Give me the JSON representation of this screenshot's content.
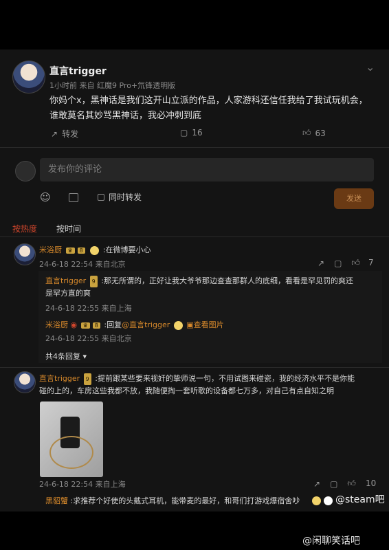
{
  "post": {
    "author": "直言trigger",
    "meta": "1小时前  来自 红魔9 Pro+氘锋透明版",
    "text_line1": "你妈个x，黑神话是我们这开山立派的作品，人家游科还信任我给了我试玩机会，",
    "text_line2": "谁敢莫名其妙骂黑神话，我必冲刺到底",
    "repost_label": "转发",
    "comment_count": "16",
    "like_count": "63"
  },
  "composer": {
    "placeholder": "发布你的评论",
    "repost_checkbox_label": "同时转发",
    "send_label": "发送"
  },
  "sort_tabs": {
    "hot": "按热度",
    "time": "按时间"
  },
  "comments": [
    {
      "user": "米浴厨",
      "text": ":在微博要小心",
      "meta": "24-6-18 22:54 来自北京",
      "like_count": "7",
      "replies": [
        {
          "user": "直言trigger",
          "text_line1": ":那无所谓的，正好让我大爷爷那边查查那群人的底细，看看是罕见罚的爽还",
          "text_line2": "是罕方直的爽",
          "meta": "24-6-18 22:55 来自上海"
        },
        {
          "user": "米浴厨",
          "text_prefix": ":回复",
          "mention": "@直言trigger",
          "view_image": "查看图片",
          "meta": "24-6-18 22:55 来自北京"
        }
      ],
      "more_replies": "共4条回复"
    },
    {
      "user": "直言trigger",
      "text_line1": ":提前跟某些要来视奸的挚师说一句，不用试图来碰瓷，我的经济水平不是你能",
      "text_line2": "碰的上的，车房这些我都不放，我随便掏一套听歌的设备都七万多，对自己有点自知之明",
      "meta": "24-6-18 22:54 来自上海",
      "like_count": "10"
    },
    {
      "user": "黑貂蟹",
      "text": ":求推荐个好使的头戴式耳机，能带麦的最好，和哥们打游戏爆宿舍吵"
    }
  ],
  "overlay": {
    "steam_tag": "@steam吧",
    "watermark": "@闲聊笑话吧"
  },
  "colors": {
    "accent": "#d98a2b",
    "active_tab": "#d1462c",
    "background": "#141414"
  }
}
